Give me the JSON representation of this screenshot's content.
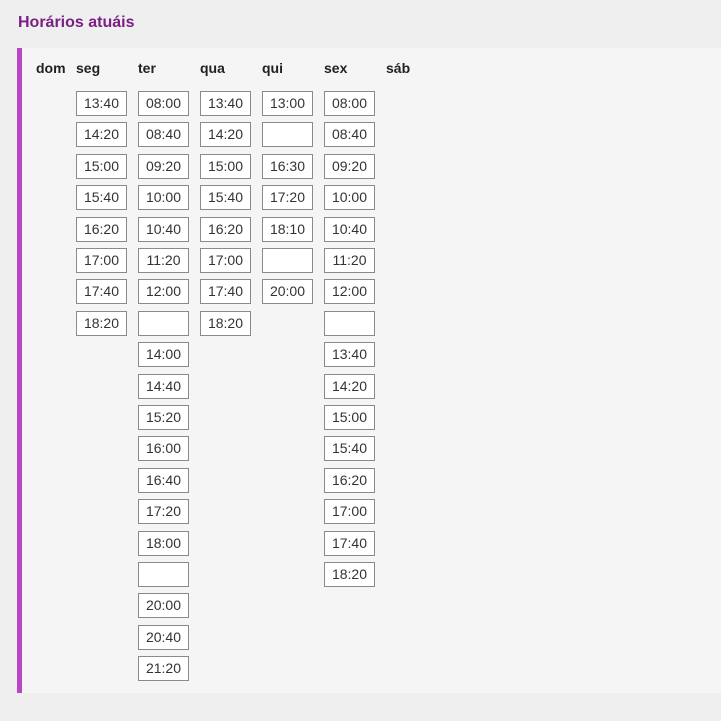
{
  "title": "Horários atuáis",
  "days": [
    {
      "key": "dom",
      "label": "dom",
      "slots": []
    },
    {
      "key": "seg",
      "label": "seg",
      "slots": [
        "13:40",
        "14:20",
        "15:00",
        "15:40",
        "16:20",
        "17:00",
        "17:40",
        "18:20"
      ]
    },
    {
      "key": "ter",
      "label": "ter",
      "slots": [
        "08:00",
        "08:40",
        "09:20",
        "10:00",
        "10:40",
        "11:20",
        "12:00",
        "",
        "14:00",
        "14:40",
        "15:20",
        "16:00",
        "16:40",
        "17:20",
        "18:00",
        "",
        "20:00",
        "20:40",
        "21:20"
      ]
    },
    {
      "key": "qua",
      "label": "qua",
      "slots": [
        "13:40",
        "14:20",
        "15:00",
        "15:40",
        "16:20",
        "17:00",
        "17:40",
        "18:20"
      ]
    },
    {
      "key": "qui",
      "label": "qui",
      "slots": [
        "13:00",
        "",
        "16:30",
        "17:20",
        "18:10",
        "",
        "20:00"
      ]
    },
    {
      "key": "sex",
      "label": "sex",
      "slots": [
        "08:00",
        "08:40",
        "09:20",
        "10:00",
        "10:40",
        "11:20",
        "12:00",
        "",
        "13:40",
        "14:20",
        "15:00",
        "15:40",
        "16:20",
        "17:00",
        "17:40",
        "18:20"
      ]
    },
    {
      "key": "sab",
      "label": "sáb",
      "slots": []
    }
  ]
}
